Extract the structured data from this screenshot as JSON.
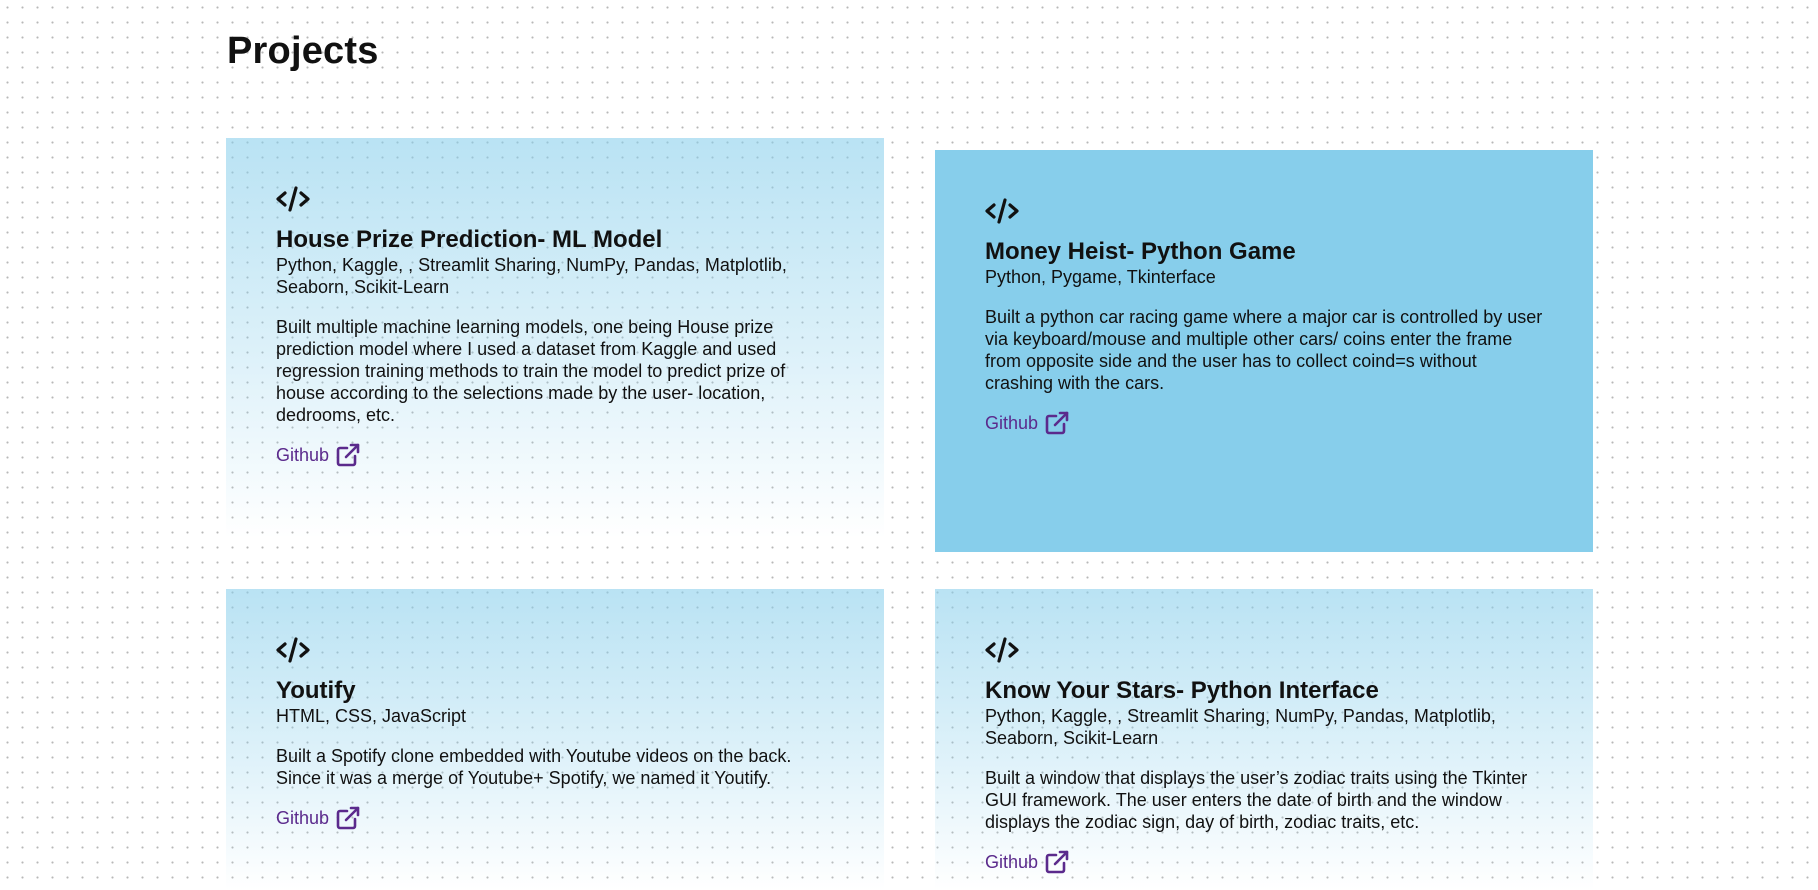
{
  "section": {
    "title": "Projects"
  },
  "projects": [
    {
      "icon": "code-icon",
      "title": "House Prize Prediction- ML Model",
      "tech": "Python, Kaggle, , Streamlit Sharing, NumPy, Pandas, Matplotlib, Seaborn, Scikit-Learn",
      "description": "Built multiple machine learning models, one being House prize prediction model where I used a dataset from Kaggle and used regression training methods to train the model to predict prize of house according to the selections made by the user- location, dedrooms, etc.",
      "link_label": "Github",
      "link_icon": "external-link-icon"
    },
    {
      "icon": "code-icon",
      "title": "Money Heist- Python Game",
      "tech": "Python, Pygame, Tkinterface",
      "description": "Built a python car racing game where a major car is controlled by user via keyboard/mouse and multiple other cars/ coins enter the frame from opposite side and the user has to collect coind=s without crashing with the cars.",
      "link_label": "Github",
      "link_icon": "external-link-icon"
    },
    {
      "icon": "code-icon",
      "title": "Youtify",
      "tech": "HTML, CSS, JavaScript",
      "description": "Built a Spotify clone embedded with Youtube videos on the back. Since it was a merge of Youtube+ Spotify, we named it Youtify.",
      "link_label": "Github",
      "link_icon": "external-link-icon"
    },
    {
      "icon": "code-icon",
      "title": "Know Your Stars- Python Interface",
      "tech": "Python, Kaggle, , Streamlit Sharing, NumPy, Pandas, Matplotlib, Seaborn, Scikit-Learn",
      "description": "Built a window that displays the user’s zodiac traits using the Tkinter GUI framework. The user enters the date of birth and the window displays the zodiac sign, day of birth, zodiac traits, etc.",
      "link_label": "Github",
      "link_icon": "external-link-icon"
    }
  ],
  "colors": {
    "card_active": "#87ceeb",
    "card_gradient_top": "#bde3f3",
    "link": "#5b2a8c",
    "text": "#111111",
    "dot_grid": "#b8b8b8"
  }
}
